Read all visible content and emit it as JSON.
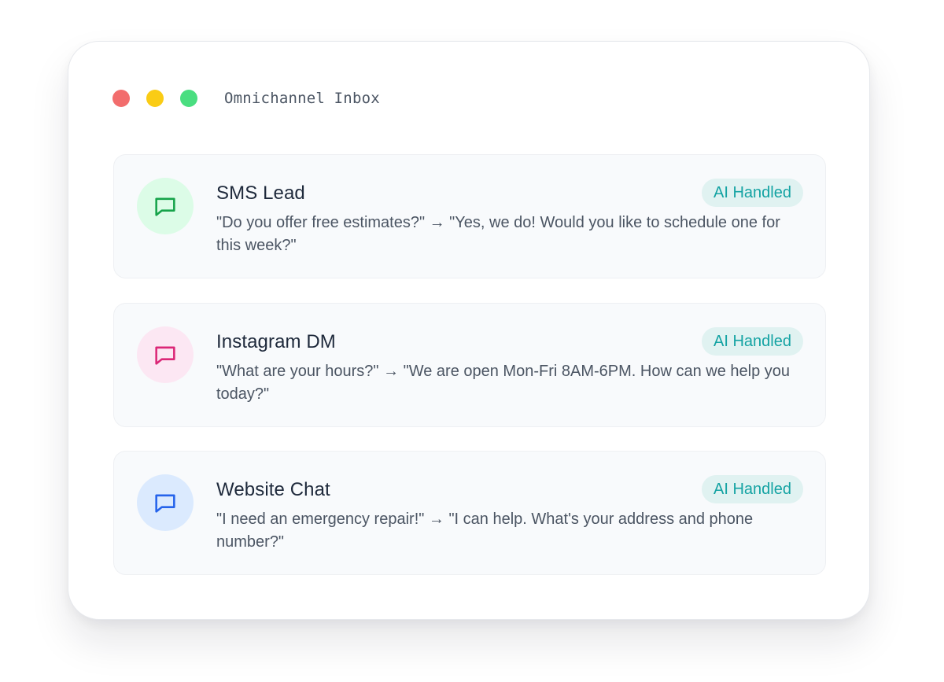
{
  "window": {
    "title": "Omnichannel Inbox"
  },
  "conversations": [
    {
      "channel": "SMS Lead",
      "badge": "AI Handled",
      "message": "\"Do you offer free estimates?\" → \"Yes, we do! Would you like to schedule one for this week?\"",
      "icon": "chat-bubble-icon",
      "icon_color": "#16a34a",
      "icon_bg": "#dcfce7"
    },
    {
      "channel": "Instagram DM",
      "badge": "AI Handled",
      "message": "\"What are your hours?\" → \"We are open Mon-Fri 8AM-6PM. How can we help you today?\"",
      "icon": "chat-bubble-icon",
      "icon_color": "#db2777",
      "icon_bg": "#fce7f3"
    },
    {
      "channel": "Website Chat",
      "badge": "AI Handled",
      "message": "\"I need an emergency repair!\" → \"I can help. What's your address and phone number?\"",
      "icon": "chat-bubble-icon",
      "icon_color": "#2563eb",
      "icon_bg": "#dbeafe"
    }
  ],
  "colors": {
    "badge_bg": "#e0f2f1",
    "badge_text": "#14a3a3",
    "dot_close": "#f26d6d",
    "dot_minimize": "#facc15",
    "dot_maximize": "#4ade80"
  }
}
